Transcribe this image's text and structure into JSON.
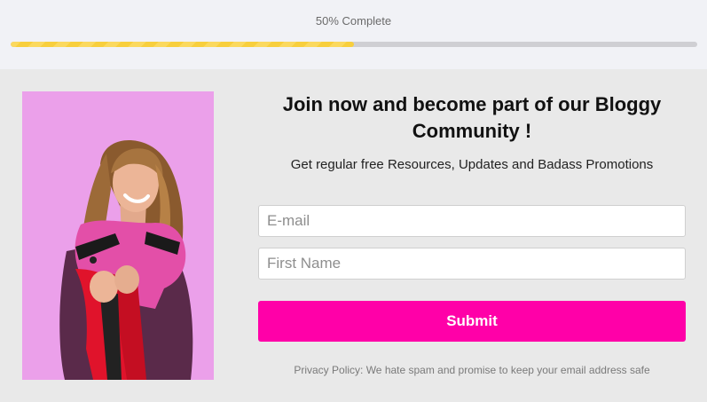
{
  "progress": {
    "label": "50% Complete",
    "percent": 50,
    "color": "#f8cf3d"
  },
  "signup": {
    "headline": "Join now and become part of our Bloggy Community !",
    "subtitle": "Get regular free Resources, Updates and Badass Promotions",
    "email_placeholder": "E-mail",
    "first_name_placeholder": "First Name",
    "submit_label": "Submit",
    "privacy_text": "Privacy Policy: We hate spam and promise to keep your email address safe",
    "accent_color": "#ff00a8"
  }
}
